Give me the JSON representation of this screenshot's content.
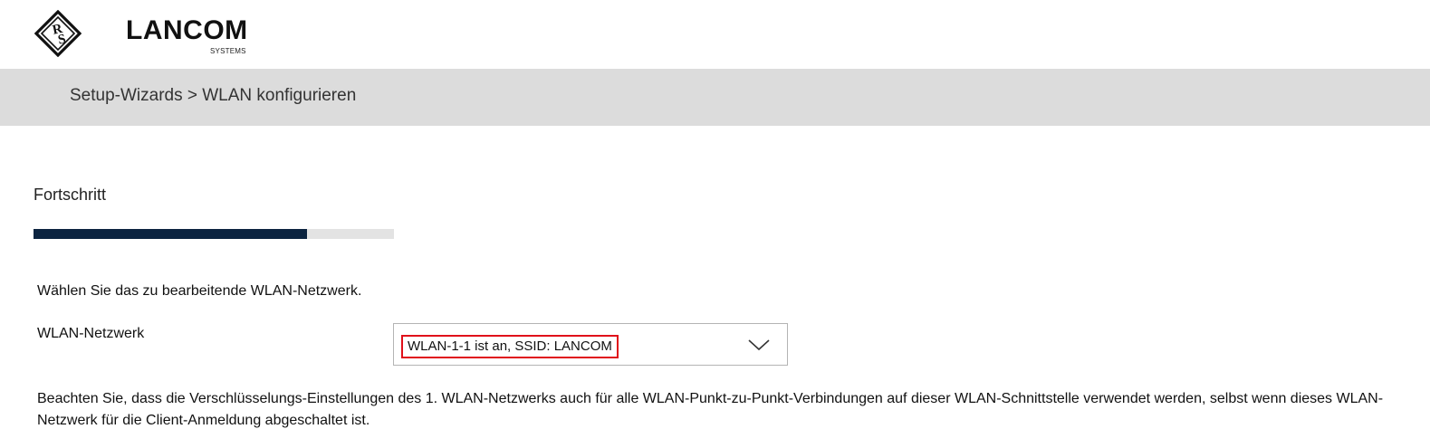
{
  "header": {
    "brand_name": "LANCOM",
    "brand_sub": "SYSTEMS",
    "rs_logo_icon": "rohde-schwarz-diamond-icon"
  },
  "breadcrumb": {
    "text": "Setup-Wizards > WLAN konfigurieren"
  },
  "progress": {
    "label": "Fortschritt",
    "fraction": 0.76,
    "fill_color": "#0c2440",
    "track_color": "#e3e3e3"
  },
  "form": {
    "instruction": "Wählen Sie das zu bearbeitende WLAN-Netzwerk.",
    "wlan_network_label": "WLAN-Netzwerk",
    "wlan_network_selected": "WLAN-1-1 ist an, SSID: LANCOM",
    "dropdown_icon": "chevron-down-icon",
    "highlight_color": "#e0101a"
  },
  "note": {
    "text": "Beachten Sie, dass die Verschlüsselungs-Einstellungen des 1. WLAN-Netzwerks auch für alle WLAN-Punkt-zu-Punkt-Verbindungen auf dieser WLAN-Schnittstelle verwendet werden, selbst wenn dieses WLAN-Netzwerk für die Client-Anmeldung abgeschaltet ist."
  }
}
